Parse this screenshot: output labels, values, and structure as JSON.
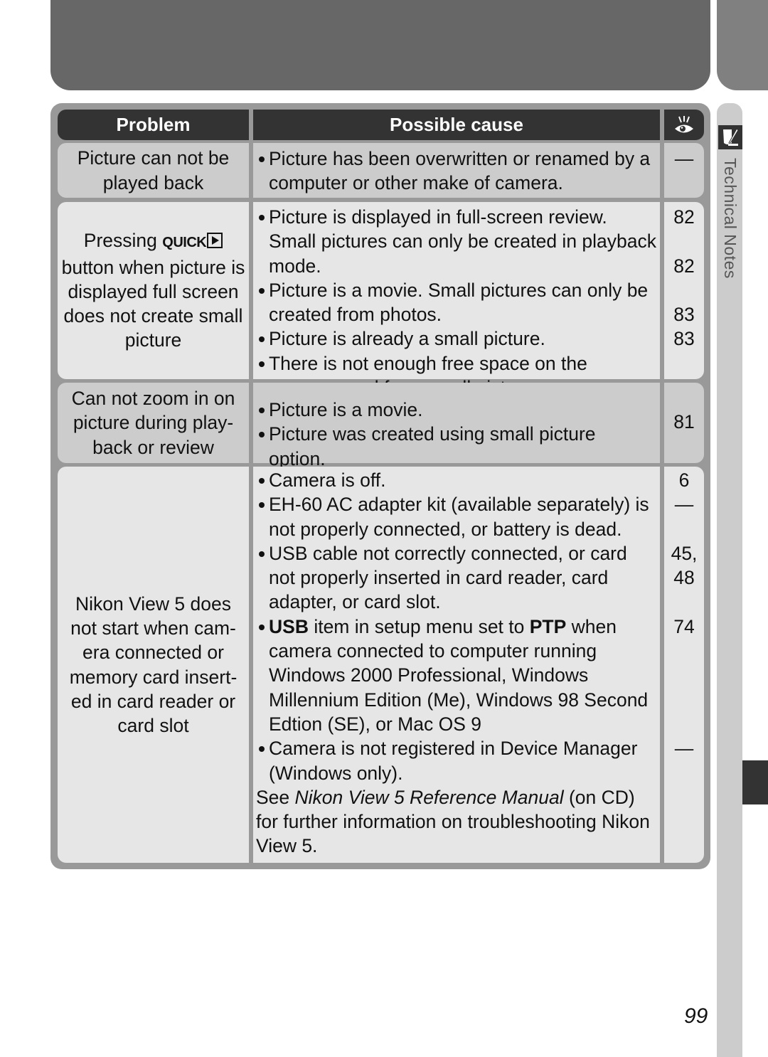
{
  "side_tab": {
    "label": "Technical Notes",
    "icon": "pen-paper-icon"
  },
  "table": {
    "headers": {
      "problem": "Problem",
      "cause": "Possible cause",
      "page_icon": "eye-icon"
    },
    "rows": [
      {
        "problem": "Picture can not be played back",
        "causes": [
          {
            "text": "Picture has been overwritten or renamed by a computer or other make of camera.",
            "page": "—"
          }
        ]
      },
      {
        "problem_prefix": "Pressing",
        "problem_button": "QUICK",
        "problem_suffix": "button when picture is displayed full screen does not create small picture",
        "causes": [
          {
            "text": "Picture is displayed in full-screen review.  Small pictures can only be created in playback mode.",
            "page": "82"
          },
          {
            "text": "Picture is a movie.  Small pictures can only be created from photos.",
            "page": "82"
          },
          {
            "text": "Picture is already a small picture.",
            "page": "83"
          },
          {
            "text": "There is not enough free space on the memory card for a small picture.",
            "page": "83"
          }
        ]
      },
      {
        "problem": "Can not zoom in on picture during play-back or review",
        "causes": [
          {
            "text": "Picture is a movie."
          },
          {
            "text": "Picture was created using small picture option."
          }
        ],
        "page": "81"
      },
      {
        "problem": "Nikon View 5 does not start when cam-era connected or memory card insert-ed in card reader or card slot",
        "causes": [
          {
            "text": "Camera is off.",
            "page": "6"
          },
          {
            "text": "EH-60 AC adapter kit (available separately) is not properly connected, or battery is dead.",
            "page": "—"
          },
          {
            "text": "USB cable not correctly connected, or card not properly inserted in card reader, card adapter, or card slot.",
            "page": "45, 48"
          },
          {
            "bold1": "USB",
            "mid": " item in setup menu set to ",
            "bold2": "PTP",
            "rest": " when camera connected to computer running Windows 2000 Professional, Windows Millennium Edition (Me), Windows 98 Second Edtion (SE), or Mac OS 9",
            "page": "74"
          },
          {
            "text": "Camera is not registered in Device Manager (Windows only).",
            "page": "—"
          }
        ],
        "note_prefix": "See ",
        "note_italic": "Nikon View 5 Reference Manual",
        "note_suffix": " (on CD) for further information on troubleshooting Nikon View 5."
      }
    ]
  },
  "page_number": "99"
}
